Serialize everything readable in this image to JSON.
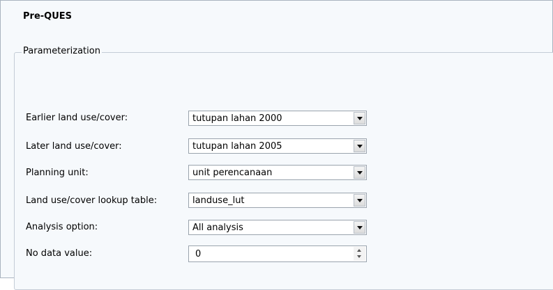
{
  "tab": {
    "title": "Pre-QUES"
  },
  "parameterization": {
    "legend": "Parameterization",
    "rows": [
      {
        "label": "Earlier land use/cover:",
        "value": "tutupan lahan 2000"
      },
      {
        "label": "Later land use/cover:",
        "value": "tutupan lahan 2005"
      },
      {
        "label": "Planning unit:",
        "value": "unit perencanaan"
      },
      {
        "label": "Land use/cover lookup table:",
        "value": "landuse_lut"
      },
      {
        "label": "Analysis option:",
        "value": "All analysis"
      }
    ],
    "nodata": {
      "label": "No data value:",
      "value": "0"
    }
  },
  "icons": {
    "dropdown": "chevron-down-icon",
    "spin_up": "spin-up-icon",
    "spin_down": "spin-down-icon"
  },
  "colors": {
    "panel_background": "#f6f9fc",
    "border": "#a9b3bf",
    "field_background": "#ffffff"
  }
}
